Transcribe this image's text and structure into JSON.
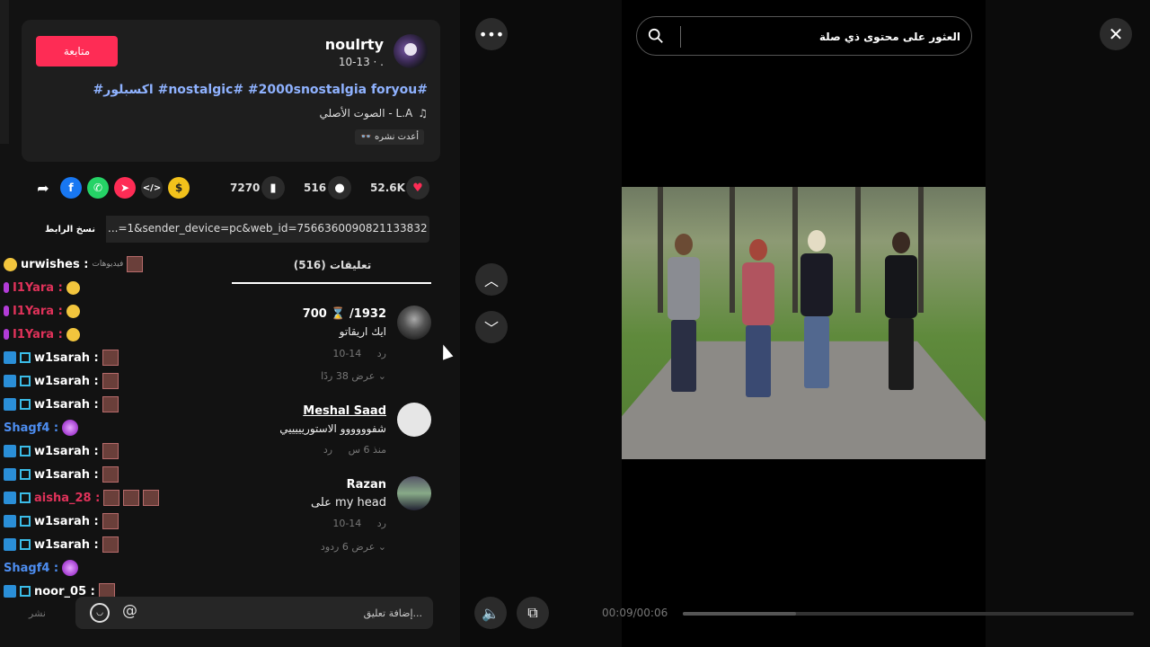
{
  "post": {
    "username": "noulrty",
    "date": "10-13 · .",
    "follow_label": "متابعة",
    "caption": "#اكسبلور #nostalgic# #2000snostalgia foryou#",
    "sound_icon": "♫",
    "sound": "الصوت الأصلي - L.A",
    "recent_tag": "👓 أعدت نشره"
  },
  "actions": {
    "likes": "52.6K",
    "comments": "516",
    "saves": "7270",
    "share_icons": [
      "share-arrow-icon",
      "facebook-icon",
      "whatsapp-icon",
      "telegram-icon",
      "embed-icon",
      "coin-icon"
    ],
    "colors": {
      "facebook": "#1877f2",
      "whatsapp": "#25d366",
      "telegram": "#fe2c55",
      "coin": "#f2c21b"
    }
  },
  "link": {
    "copy_label": "نسخ الرابط",
    "url": "...=1&sender_device=pc&web_id=7566360090821133832"
  },
  "comments_header": "(516) تعليقات",
  "comments": [
    {
      "name": "700 ⌛ /1932",
      "text": "ايك اريقاتو",
      "date": "10-14",
      "reply": "رد",
      "replies": "عرض 38 ردًا"
    },
    {
      "name": "Meshal Saad",
      "text": "شفوووووو الاستوريييييي",
      "date": "منذ 6 س",
      "reply": "رد"
    },
    {
      "name": "Razan",
      "text": "على my head",
      "date": "10-14",
      "reply": "رد",
      "replies": "عرض 6 ردود"
    }
  ],
  "chat": [
    {
      "user": "urwishes :",
      "note": "فيديوهات",
      "color": "#ffffff"
    },
    {
      "user": "I1Yara :",
      "color": "#e0325a"
    },
    {
      "user": "I1Yara :",
      "color": "#e0325a"
    },
    {
      "user": "I1Yara :",
      "color": "#e0325a"
    },
    {
      "user": "w1sarah :",
      "color": "#ffffff"
    },
    {
      "user": "w1sarah :",
      "color": "#ffffff"
    },
    {
      "user": "w1sarah :",
      "color": "#ffffff"
    },
    {
      "user": "Shagf4 :",
      "color": "#4d8df0"
    },
    {
      "user": "w1sarah :",
      "color": "#ffffff"
    },
    {
      "user": "w1sarah :",
      "color": "#ffffff"
    },
    {
      "user": "aisha_28 :",
      "color": "#e0325a"
    },
    {
      "user": "w1sarah :",
      "color": "#ffffff"
    },
    {
      "user": "w1sarah :",
      "color": "#ffffff"
    },
    {
      "user": "Shagf4 :",
      "color": "#4d8df0"
    },
    {
      "user": "noor_05 :",
      "color": "#ffffff"
    }
  ],
  "comment_box": {
    "placeholder": "إضافة تعليق...",
    "post_label": "نشر"
  },
  "search": {
    "placeholder": "العثور على محتوى ذي صلة"
  },
  "player": {
    "timecode": "00:09/00:06",
    "progress": 0.25
  },
  "accent": "#fe2c55"
}
